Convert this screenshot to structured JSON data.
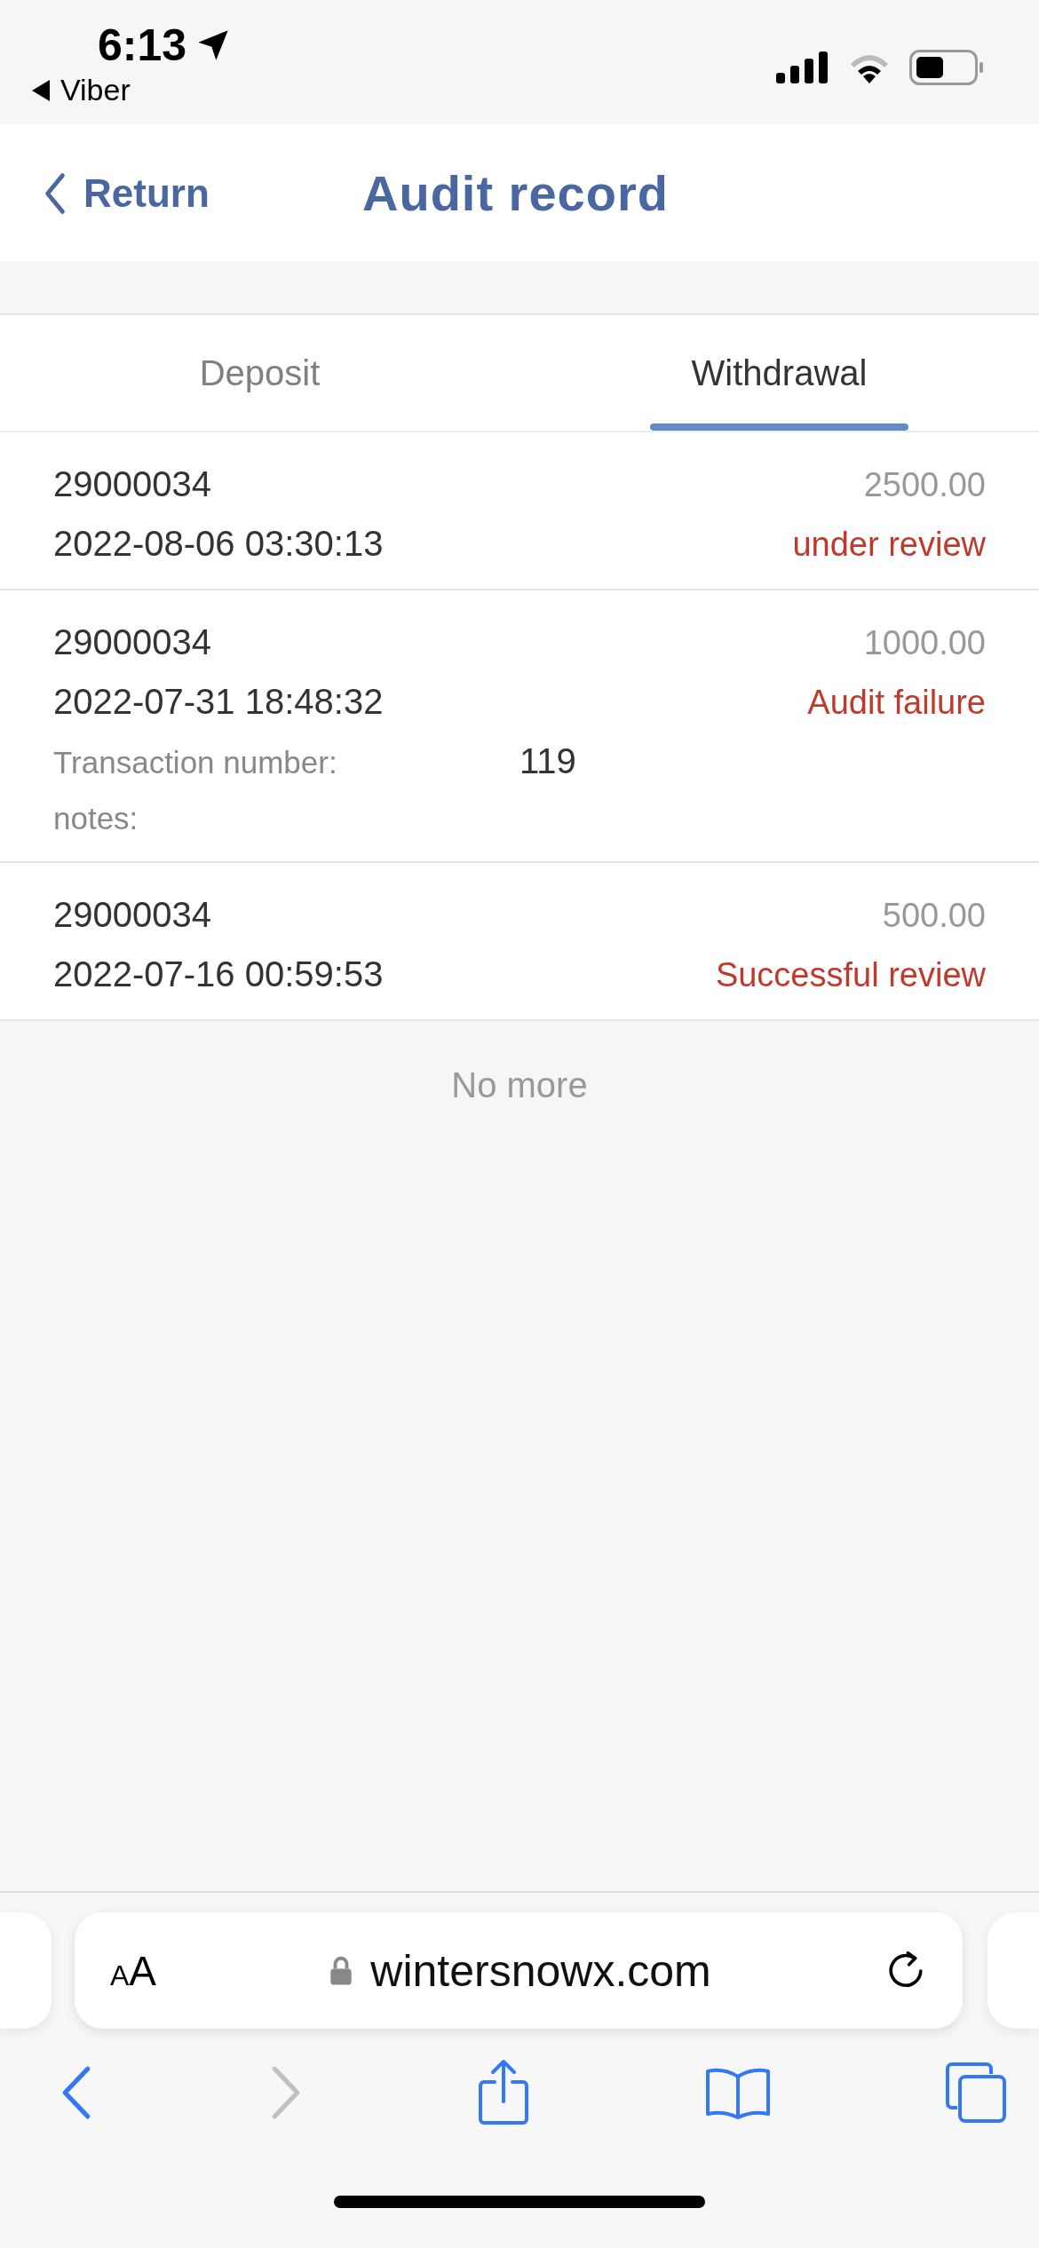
{
  "status_bar": {
    "time": "6:13",
    "back_app": "Viber"
  },
  "header": {
    "back_label": "Return",
    "title": "Audit record"
  },
  "tabs": [
    {
      "label": "Deposit",
      "selected": false
    },
    {
      "label": "Withdrawal",
      "selected": true
    }
  ],
  "records": [
    {
      "id": "29000034",
      "amount": "2500.00",
      "datetime": "2022-08-06 03:30:13",
      "status": "under review"
    },
    {
      "id": "29000034",
      "amount": "1000.00",
      "datetime": "2022-07-31 18:48:32",
      "status": "Audit failure",
      "details": [
        {
          "label": "Transaction number:",
          "value": "119"
        },
        {
          "label": "notes:"
        }
      ]
    },
    {
      "id": "29000034",
      "amount": "500.00",
      "datetime": "2022-07-16 00:59:53",
      "status": "Successful review"
    }
  ],
  "end_message": "No more",
  "browser": {
    "text_size_small": "A",
    "text_size_large": "A",
    "url": "wintersnowx.com",
    "back_disabled": false,
    "forward_disabled": true
  }
}
